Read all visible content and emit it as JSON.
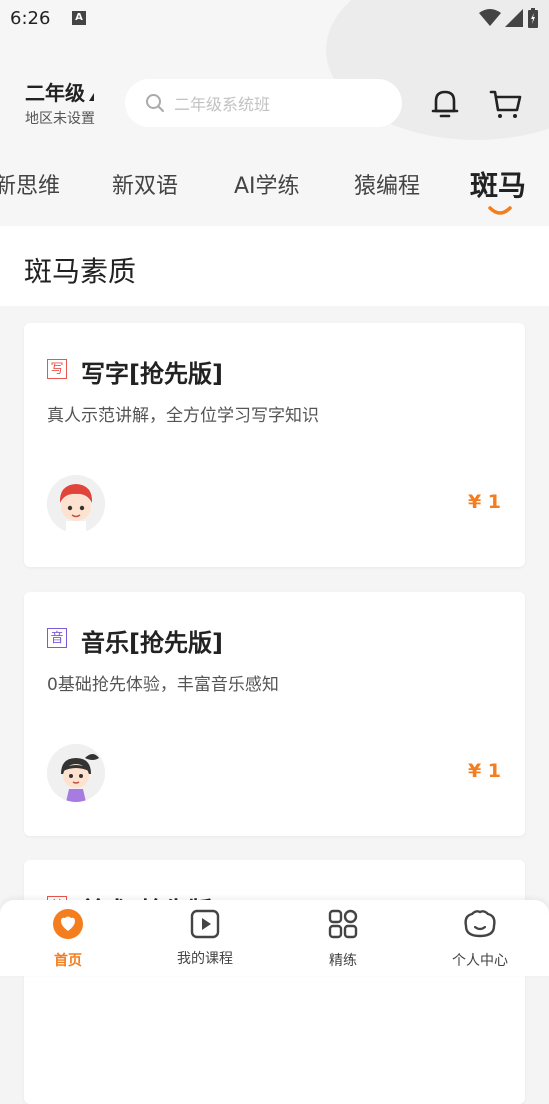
{
  "status_bar": {
    "time": "6:26",
    "a_badge": "A"
  },
  "header": {
    "grade_title": "二年级",
    "grade_sub": "地区未设置",
    "search_placeholder": "二年级系统班"
  },
  "tabs": [
    {
      "label": "新思维",
      "active": false
    },
    {
      "label": "新双语",
      "active": false
    },
    {
      "label": "AI学练",
      "active": false
    },
    {
      "label": "猿编程",
      "active": false
    },
    {
      "label": "斑马",
      "active": true
    }
  ],
  "section": {
    "title": "斑马素质"
  },
  "cards": [
    {
      "badge": "写",
      "badge_color": "#e8554e",
      "title": "写字[抢先版]",
      "desc": "真人示范讲解，全方位学习写字知识",
      "price": "¥ 1"
    },
    {
      "badge": "音",
      "badge_color": "#7b5bd6",
      "title": "音乐[抢先版]",
      "desc": "0基础抢先体验，丰富音乐感知",
      "price": "¥ 1"
    },
    {
      "badge": "美",
      "badge_color": "#e8554e",
      "title": "美术[抢先版]",
      "desc": "",
      "price": ""
    }
  ],
  "bottom_nav": [
    {
      "label": "首页",
      "icon": "home-icon",
      "active": true
    },
    {
      "label": "我的课程",
      "icon": "play-icon",
      "active": false
    },
    {
      "label": "精练",
      "icon": "grid-icon",
      "active": false
    },
    {
      "label": "个人中心",
      "icon": "face-icon",
      "active": false
    }
  ],
  "colors": {
    "accent": "#f47d1e",
    "background": "#f5f5f5"
  }
}
